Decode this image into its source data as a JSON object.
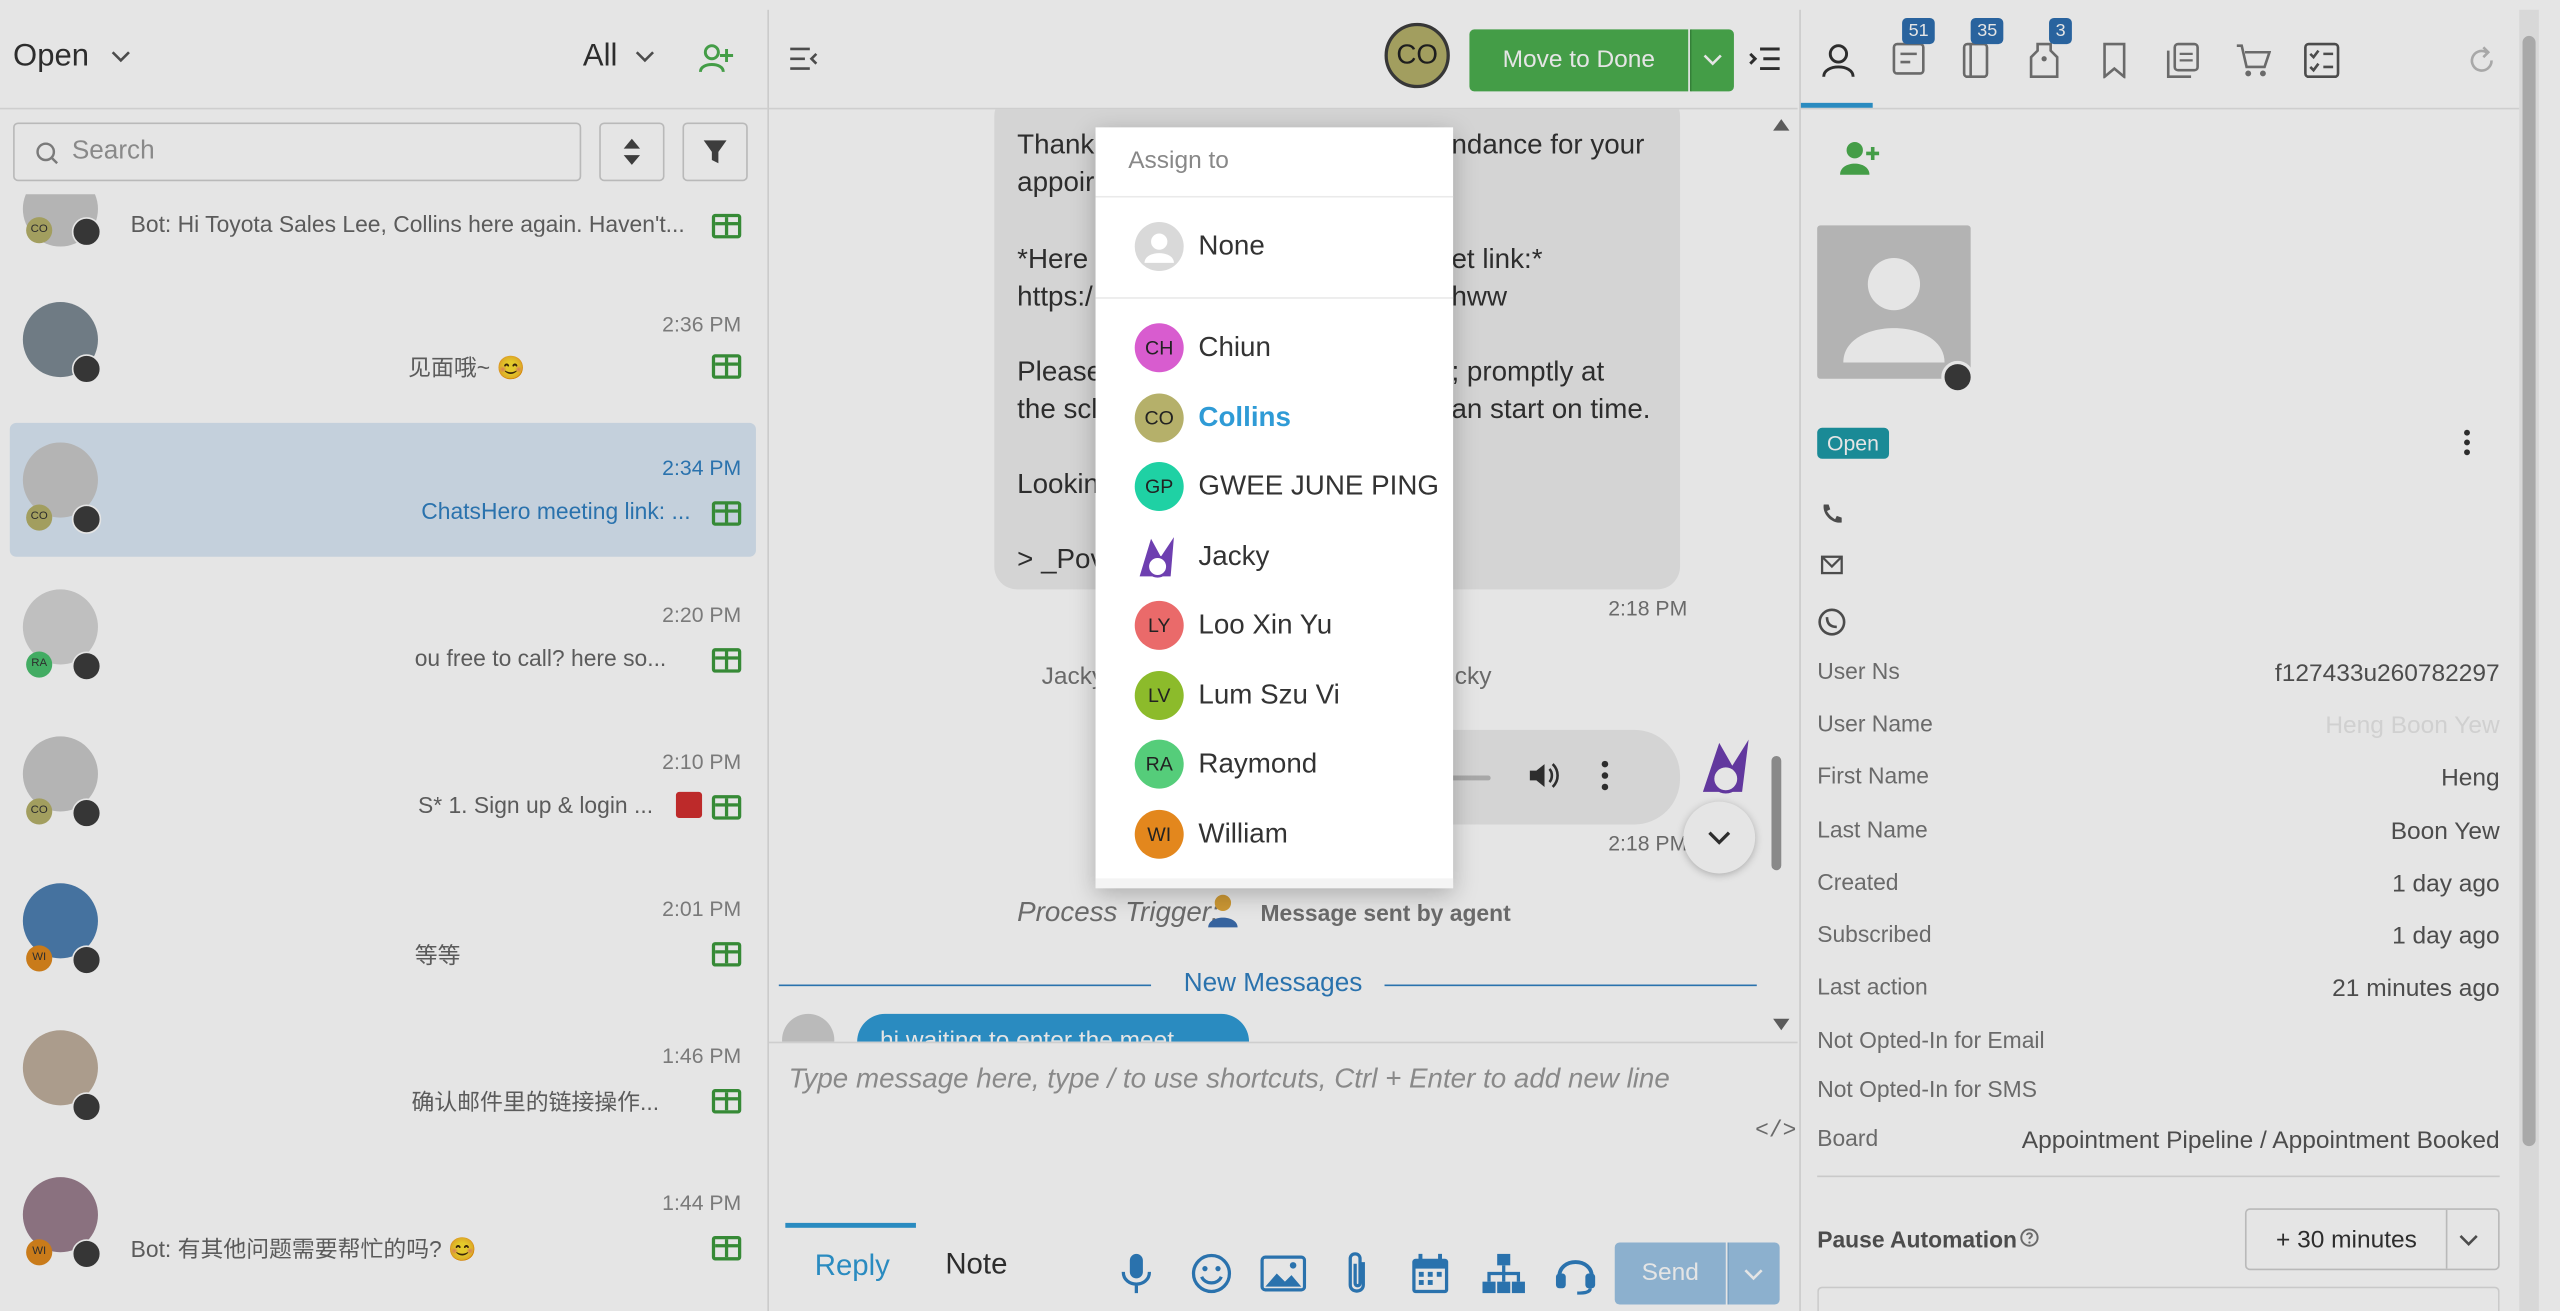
{
  "left": {
    "filter_label": "Open",
    "scope_label": "All",
    "search_placeholder": "Search",
    "conversations": [
      {
        "time": "",
        "preview": "Bot: Hi Toyota Sales Lee, Collins here again. Haven't...",
        "badge": "CO",
        "badge_color": "#b5b06a"
      },
      {
        "time": "2:36 PM",
        "preview": "见面哦~ 😊",
        "badge": "",
        "badge_color": ""
      },
      {
        "time": "2:34 PM",
        "preview": "ChatsHero meeting link: ...",
        "badge": "CO",
        "badge_color": "#b5b06a"
      },
      {
        "time": "2:20 PM",
        "preview": "ou free to call? here so...",
        "badge": "RA",
        "badge_color": "#4bc06f"
      },
      {
        "time": "2:10 PM",
        "preview": "S* 1. Sign up & login ...",
        "badge": "CO",
        "badge_color": "#b5b06a"
      },
      {
        "time": "2:01 PM",
        "preview": "等等",
        "badge": "WI",
        "badge_color": "#e08a1e"
      },
      {
        "time": "1:46 PM",
        "preview": "确认邮件里的链接操作...",
        "badge": "",
        "badge_color": ""
      },
      {
        "time": "1:44 PM",
        "preview": "Bot: 有其他问题需要帮忙的吗? 😊",
        "badge": "WI",
        "badge_color": "#e08a1e"
      }
    ]
  },
  "middle": {
    "agent_initials": "CO",
    "move_to_done_label": "Move to Done",
    "message_lines": [
      "Thank",
      "appoir",
      "*Here",
      "https:/",
      "Please",
      "the scl",
      "Lookin",
      "> _Pov"
    ],
    "message_right_lines": [
      "ndance for your",
      "et link:*",
      "hww",
      "; promptly at",
      "an start on time."
    ],
    "msg_time_1": "2:18 PM",
    "left_fragment": "Jacky",
    "right_fragment": "cky",
    "msg_time_2": "2:18 PM",
    "process_trigger": "Process Trigger:",
    "message_sent_by": "Message sent by agent",
    "new_messages": "New Messages",
    "incoming_bubble": "hi waiting to enter the meet",
    "composer_placeholder": "Type message here, type / to use shortcuts, Ctrl + Enter to add new line",
    "reply_tab": "Reply",
    "note_tab": "Note",
    "send_label": "Send"
  },
  "assign": {
    "title": "Assign to",
    "options": [
      {
        "initials": "",
        "name": "None",
        "color": "#d9d9d9"
      },
      {
        "initials": "CH",
        "name": "Chiun",
        "color": "#d85ccf"
      },
      {
        "initials": "CO",
        "name": "Collins",
        "color": "#b5b06a",
        "selected": true
      },
      {
        "initials": "GP",
        "name": "GWEE JUNE PING",
        "color": "#1fd1a4"
      },
      {
        "initials": "",
        "name": "Jacky",
        "color": ""
      },
      {
        "initials": "LY",
        "name": "Loo Xin Yu",
        "color": "#ea6a6a"
      },
      {
        "initials": "LV",
        "name": "Lum Szu Vi",
        "color": "#8cbb2b"
      },
      {
        "initials": "RA",
        "name": "Raymond",
        "color": "#55cd7a"
      },
      {
        "initials": "WI",
        "name": "William",
        "color": "#e3871d"
      }
    ]
  },
  "right": {
    "tab_badges": [
      "51",
      "35",
      "3"
    ],
    "status": "Open",
    "fields": [
      {
        "key": "User Ns",
        "value": "f127433u260782297"
      },
      {
        "key": "User Name",
        "value": "Heng Boon Yew"
      },
      {
        "key": "First Name",
        "value": "Heng"
      },
      {
        "key": "Last Name",
        "value": "Boon Yew"
      },
      {
        "key": "Created",
        "value": "1 day ago"
      },
      {
        "key": "Subscribed",
        "value": "1 day ago"
      },
      {
        "key": "Last action",
        "value": "21 minutes ago"
      }
    ],
    "not_opted_email": "Not Opted-In for Email",
    "not_opted_sms": "Not Opted-In for SMS",
    "board_key": "Board",
    "board_value": "Appointment Pipeline / Appointment Booked",
    "pause_label": "Pause Automation",
    "pause_value": "+ 30 minutes"
  },
  "colors": {
    "accent_green": "#4caf50",
    "link_blue": "#2f9bd6",
    "status_teal": "#1d9aa8"
  }
}
